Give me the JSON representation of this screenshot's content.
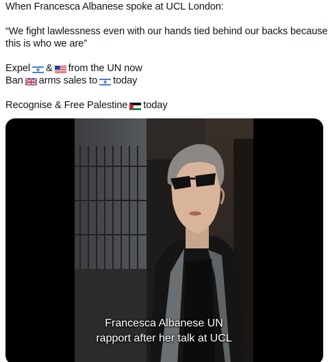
{
  "post": {
    "line1": "When Francesca Albanese spoke at UCL London:",
    "quote_line1": "“We fight lawlessness even with our hands tied behind our backs because",
    "quote_line2": "this is who we are”",
    "expel_prefix": "Expel",
    "expel_amp": "&",
    "expel_suffix": "from the UN now",
    "ban_prefix": "Ban",
    "ban_middle": "arms sales to",
    "ban_suffix": "today",
    "recognise_prefix": "Recognise & Free Palestine",
    "recognise_suffix": "today",
    "flags": [
      "israel-flag-icon",
      "usa-flag-icon",
      "uk-flag-icon",
      "israel-flag-icon",
      "palestine-flag-icon"
    ]
  },
  "video": {
    "caption_line1": "Francesca Albanese UN",
    "caption_line2": "rapport after her talk at UCL"
  }
}
